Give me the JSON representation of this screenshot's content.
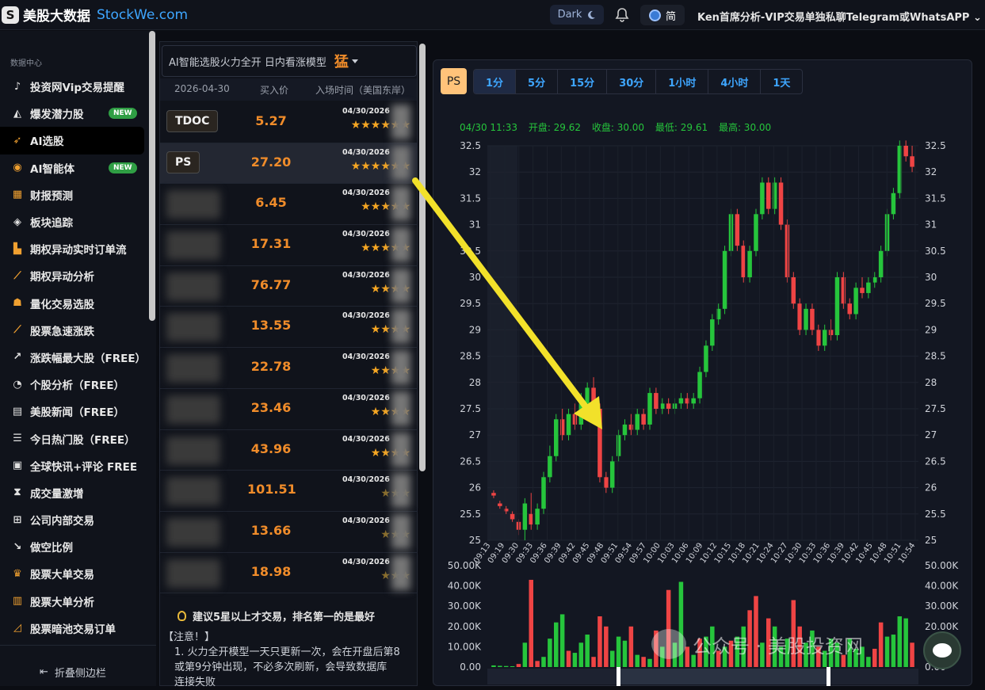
{
  "topbar": {
    "logo_cn": "美股大数据",
    "logo_en": "StockWe.com",
    "theme_label": "Dark",
    "lang_label": "简",
    "promo": "Ken首席分析-VIP交易单独私聊Telegram或WhatsAPP"
  },
  "sidebar": {
    "section": "数据中心",
    "items": [
      {
        "label": "投资网Vip交易提醒",
        "icon": "bell-icon"
      },
      {
        "label": "爆发潜力股",
        "icon": "chart-icon",
        "badge": "NEW"
      },
      {
        "label": "AI选股",
        "icon": "rocket-icon",
        "active": true
      },
      {
        "label": "AI智能体",
        "icon": "ai-icon",
        "badge": "NEW"
      },
      {
        "label": "财报预测",
        "icon": "calendar-icon"
      },
      {
        "label": "板块追踪",
        "icon": "layers-icon"
      },
      {
        "label": "期权异动实时订单流",
        "icon": "bar-chart-icon"
      },
      {
        "label": "期权异动分析",
        "icon": "line-chart-icon"
      },
      {
        "label": "量化交易选股",
        "icon": "robot-icon"
      },
      {
        "label": "股票急速涨跌",
        "icon": "trend-icon"
      },
      {
        "label": "涨跌幅最大股（FREE）",
        "icon": "trend-up-icon"
      },
      {
        "label": "个股分析（FREE）",
        "icon": "pie-icon"
      },
      {
        "label": "美股新闻（FREE）",
        "icon": "news-icon"
      },
      {
        "label": "今日热门股（FREE）",
        "icon": "list-icon"
      },
      {
        "label": "全球快讯+评论 FREE",
        "icon": "book-icon"
      },
      {
        "label": "成交量激增",
        "icon": "hourglass-icon"
      },
      {
        "label": "公司内部交易",
        "icon": "sitemap-icon"
      },
      {
        "label": "做空比例",
        "icon": "trend-down-icon"
      },
      {
        "label": "股票大单交易",
        "icon": "crown-icon"
      },
      {
        "label": "股票大单分析",
        "icon": "bars-icon"
      },
      {
        "label": "股票暗池交易订单",
        "icon": "area-chart-icon"
      }
    ],
    "collapse_label": "折叠侧边栏"
  },
  "picker": {
    "model_label": "AI智能选股火力全开 日内看涨模型",
    "model_value": "猛",
    "col_date": "2026-04-30",
    "col_price": "买入价",
    "col_time": "入场时间（美国东岸）",
    "rows": [
      {
        "ticker": "TDOC",
        "price": "5.27",
        "date": "04/30/2026",
        "stars": 6,
        "dim": false
      },
      {
        "ticker": "PS",
        "price": "27.20",
        "date": "04/30/2026",
        "stars": 6,
        "dim": false,
        "highlight": true
      },
      {
        "ticker": "",
        "price": "6.45",
        "date": "04/30/2026",
        "stars": 5,
        "dim": false
      },
      {
        "ticker": "",
        "price": "17.31",
        "date": "04/30/2026",
        "stars": 5,
        "dim": false
      },
      {
        "ticker": "",
        "price": "76.77",
        "date": "04/30/2026",
        "stars": 4,
        "dim": false
      },
      {
        "ticker": "",
        "price": "13.55",
        "date": "04/30/2026",
        "stars": 4,
        "dim": false
      },
      {
        "ticker": "",
        "price": "22.78",
        "date": "04/30/2026",
        "stars": 4,
        "dim": false
      },
      {
        "ticker": "",
        "price": "23.46",
        "date": "04/30/2026",
        "stars": 4,
        "dim": false
      },
      {
        "ticker": "",
        "price": "43.96",
        "date": "04/30/2026",
        "stars": 4,
        "dim": false
      },
      {
        "ticker": "",
        "price": "101.51",
        "date": "04/30/2026",
        "stars": 3,
        "dim": true
      },
      {
        "ticker": "",
        "price": "13.66",
        "date": "04/30/2026",
        "stars": 3,
        "dim": true
      },
      {
        "ticker": "",
        "price": "18.98",
        "date": "04/30/2026",
        "stars": 3,
        "dim": true
      }
    ],
    "tip": "建议5星以上才交易，排名第一的是最好",
    "notes_title": "【注意！】",
    "notes_1": "1. 火力全开模型一天只更新一次，会在开盘后第8",
    "notes_2": "或第9分钟出现，不必多次刷新，会导致数据库",
    "notes_3": "连接失败"
  },
  "chart": {
    "symbol": "PS",
    "intervals": [
      "1分",
      "5分",
      "15分",
      "30分",
      "1小时",
      "4小时",
      "1天"
    ],
    "active_interval": "1分",
    "ohlc": {
      "time": "04/30 11:33",
      "open": "开盘: 29.62",
      "close": "收盘: 30.00",
      "low": "最低: 29.61",
      "high": "最高: 30.00"
    },
    "up_color": "#26c53c",
    "down_color": "#ef4444"
  },
  "chart_data": {
    "type": "candlestick",
    "y_ticks": [
      "32.5",
      "32",
      "31.5",
      "31",
      "30.5",
      "30",
      "29.5",
      "29",
      "28.5",
      "28",
      "27.5",
      "27",
      "26.5",
      "26",
      "25.5",
      "25"
    ],
    "ylim": [
      25,
      32.5
    ],
    "x_ticks": [
      "09:13",
      "09:19",
      "09:30",
      "09:33",
      "09:36",
      "09:39",
      "09:42",
      "09:45",
      "09:48",
      "09:51",
      "09:54",
      "09:57",
      "10:00",
      "10:03",
      "10:06",
      "10:09",
      "10:12",
      "10:15",
      "10:18",
      "10:21",
      "10:24",
      "10:27",
      "10:30",
      "10:33",
      "10:36",
      "10:39",
      "10:42",
      "10:45",
      "10:48",
      "10:51",
      "10:54"
    ],
    "candles": [
      [
        25.9,
        25.85,
        25.8,
        25.95
      ],
      [
        25.7,
        25.65,
        25.6,
        25.75
      ],
      [
        25.6,
        25.55,
        25.5,
        25.65
      ],
      [
        25.5,
        25.4,
        25.35,
        25.55
      ],
      [
        25.35,
        25.2,
        25.1,
        25.4
      ],
      [
        25.2,
        25.7,
        25.0,
        25.8
      ],
      [
        25.5,
        25.3,
        25.2,
        25.9
      ],
      [
        25.3,
        25.6,
        25.2,
        25.7
      ],
      [
        25.6,
        26.2,
        25.5,
        26.3
      ],
      [
        26.2,
        26.6,
        26.1,
        26.8
      ],
      [
        26.6,
        27.3,
        26.5,
        27.4
      ],
      [
        27.3,
        27.0,
        26.9,
        27.5
      ],
      [
        27.0,
        27.4,
        26.9,
        27.5
      ],
      [
        27.4,
        27.2,
        27.1,
        27.6
      ],
      [
        27.2,
        27.6,
        27.1,
        27.8
      ],
      [
        27.6,
        27.9,
        27.5,
        28.0
      ],
      [
        27.9,
        27.5,
        27.4,
        28.1
      ],
      [
        27.5,
        26.2,
        26.1,
        27.6
      ],
      [
        26.2,
        26.0,
        25.9,
        26.3
      ],
      [
        26.0,
        26.5,
        25.9,
        26.6
      ],
      [
        26.6,
        27.0,
        26.5,
        27.1
      ],
      [
        27.0,
        27.2,
        26.9,
        27.3
      ],
      [
        27.2,
        27.1,
        27.0,
        27.4
      ],
      [
        27.1,
        27.4,
        27.0,
        27.5
      ],
      [
        27.4,
        27.2,
        27.1,
        27.5
      ],
      [
        27.2,
        27.8,
        27.1,
        27.9
      ],
      [
        27.8,
        27.5,
        27.4,
        27.9
      ],
      [
        27.5,
        27.6,
        27.4,
        27.7
      ],
      [
        27.6,
        27.5,
        27.4,
        27.7
      ],
      [
        27.5,
        27.6,
        27.4,
        27.7
      ],
      [
        27.6,
        27.7,
        27.5,
        27.8
      ],
      [
        27.7,
        27.6,
        27.5,
        27.8
      ],
      [
        27.6,
        27.7,
        27.5,
        27.8
      ],
      [
        27.7,
        28.2,
        27.6,
        28.3
      ],
      [
        28.2,
        28.7,
        28.1,
        28.8
      ],
      [
        28.7,
        29.2,
        28.6,
        29.3
      ],
      [
        29.2,
        29.4,
        29.1,
        29.5
      ],
      [
        29.4,
        30.5,
        29.3,
        30.6
      ],
      [
        30.5,
        31.2,
        30.4,
        31.3
      ],
      [
        31.2,
        30.6,
        30.5,
        31.3
      ],
      [
        30.6,
        30.0,
        29.9,
        30.7
      ],
      [
        30.0,
        30.5,
        29.9,
        30.6
      ],
      [
        30.5,
        31.2,
        30.4,
        31.3
      ],
      [
        31.2,
        31.8,
        31.1,
        31.9
      ],
      [
        31.8,
        31.3,
        31.2,
        31.9
      ],
      [
        31.3,
        31.8,
        31.2,
        31.9
      ],
      [
        31.8,
        31.0,
        30.9,
        31.9
      ],
      [
        31.0,
        30.0,
        29.9,
        31.1
      ],
      [
        30.0,
        29.5,
        29.4,
        30.1
      ],
      [
        29.5,
        29.0,
        28.9,
        29.6
      ],
      [
        29.0,
        29.4,
        28.9,
        29.5
      ],
      [
        29.4,
        29.0,
        28.9,
        29.5
      ],
      [
        29.0,
        28.7,
        28.6,
        29.1
      ],
      [
        28.7,
        29.0,
        28.6,
        29.1
      ],
      [
        29.0,
        28.9,
        28.8,
        29.2
      ],
      [
        28.9,
        30.0,
        28.8,
        30.1
      ],
      [
        30.0,
        29.5,
        29.4,
        30.1
      ],
      [
        29.5,
        29.3,
        29.2,
        29.6
      ],
      [
        29.3,
        29.8,
        29.2,
        29.9
      ],
      [
        29.8,
        29.7,
        29.6,
        30.0
      ],
      [
        29.7,
        29.9,
        29.6,
        30.0
      ],
      [
        29.9,
        30.0,
        29.8,
        30.1
      ],
      [
        30.0,
        30.5,
        29.9,
        30.6
      ],
      [
        30.5,
        31.2,
        30.4,
        31.3
      ],
      [
        31.2,
        31.6,
        31.1,
        31.7
      ],
      [
        31.6,
        32.5,
        31.5,
        32.6
      ],
      [
        32.5,
        32.3,
        32.2,
        32.6
      ],
      [
        32.3,
        32.1,
        32.0,
        32.5
      ]
    ],
    "volume_ticks": [
      "50.00K",
      "40.00K",
      "30.00K",
      "20.00K",
      "10.00K",
      "0.00"
    ],
    "volume_max": 50000,
    "volumes": [
      [
        800,
        0
      ],
      [
        600,
        0
      ],
      [
        500,
        0
      ],
      [
        400,
        0
      ],
      [
        1500,
        1
      ],
      [
        12000,
        0
      ],
      [
        43000,
        1
      ],
      [
        3000,
        1
      ],
      [
        5000,
        0
      ],
      [
        14000,
        0
      ],
      [
        22000,
        0
      ],
      [
        26000,
        0
      ],
      [
        8000,
        1
      ],
      [
        7000,
        0
      ],
      [
        12000,
        0
      ],
      [
        16000,
        0
      ],
      [
        5000,
        1
      ],
      [
        25000,
        1
      ],
      [
        20000,
        1
      ],
      [
        8000,
        0
      ],
      [
        15000,
        0
      ],
      [
        13000,
        0
      ],
      [
        20000,
        1
      ],
      [
        6000,
        0
      ],
      [
        5000,
        1
      ],
      [
        4000,
        0
      ],
      [
        18000,
        1
      ],
      [
        10000,
        0
      ],
      [
        38000,
        1
      ],
      [
        12000,
        0
      ],
      [
        42000,
        0
      ],
      [
        10000,
        1
      ],
      [
        6000,
        0
      ],
      [
        14000,
        1
      ],
      [
        15000,
        0
      ],
      [
        20000,
        0
      ],
      [
        8000,
        1
      ],
      [
        10000,
        0
      ],
      [
        13000,
        1
      ],
      [
        15000,
        0
      ],
      [
        20000,
        0
      ],
      [
        28000,
        1
      ],
      [
        35000,
        1
      ],
      [
        12000,
        0
      ],
      [
        24000,
        1
      ],
      [
        20000,
        0
      ],
      [
        10000,
        0
      ],
      [
        14000,
        0
      ],
      [
        33000,
        1
      ],
      [
        20000,
        1
      ],
      [
        12000,
        0
      ],
      [
        18000,
        0
      ],
      [
        10000,
        1
      ],
      [
        8000,
        0
      ],
      [
        14000,
        0
      ],
      [
        12000,
        0
      ],
      [
        6000,
        1
      ],
      [
        14000,
        0
      ],
      [
        9000,
        0
      ],
      [
        10000,
        0
      ],
      [
        5000,
        0
      ],
      [
        9000,
        1
      ],
      [
        22000,
        1
      ],
      [
        15000,
        0
      ],
      [
        16000,
        0
      ],
      [
        25000,
        0
      ],
      [
        24000,
        0
      ],
      [
        12000,
        1
      ]
    ]
  },
  "watermark": "公众号 · 美股投资网"
}
